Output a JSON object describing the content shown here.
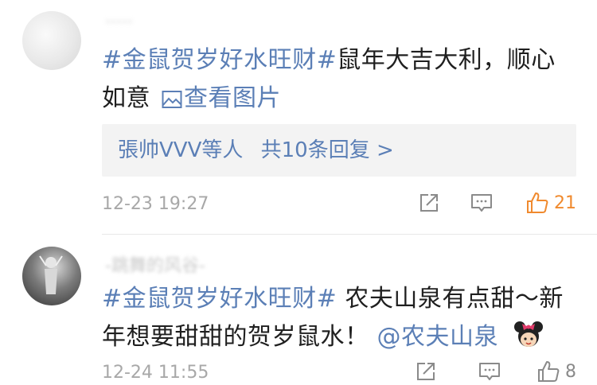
{
  "comments": [
    {
      "username": "·····",
      "topic": "#金鼠贺岁好水旺财#",
      "text": "鼠年大吉大利，顺心如意",
      "view_pic_label": "查看图片",
      "replies": {
        "users": "張帅VVV等人",
        "count": "共10条回复 >"
      },
      "time": "12-23 19:27",
      "likes": "21",
      "liked": true
    },
    {
      "username": "-跳舞的风谷-",
      "topic": "#金鼠贺岁好水旺财#",
      "text": " 农夫山泉有点甜～新年想要甜甜的贺岁鼠水！",
      "mention": "@农夫山泉",
      "time": "12-24 11:55",
      "likes": "8",
      "liked": false
    }
  ],
  "colors": {
    "link": "#5b7fb6",
    "liked": "#f08a2e",
    "meta": "#a8a8a8"
  },
  "icons": [
    "share-icon",
    "comment-icon",
    "like-icon",
    "image-icon",
    "minnie-emoji-icon"
  ]
}
